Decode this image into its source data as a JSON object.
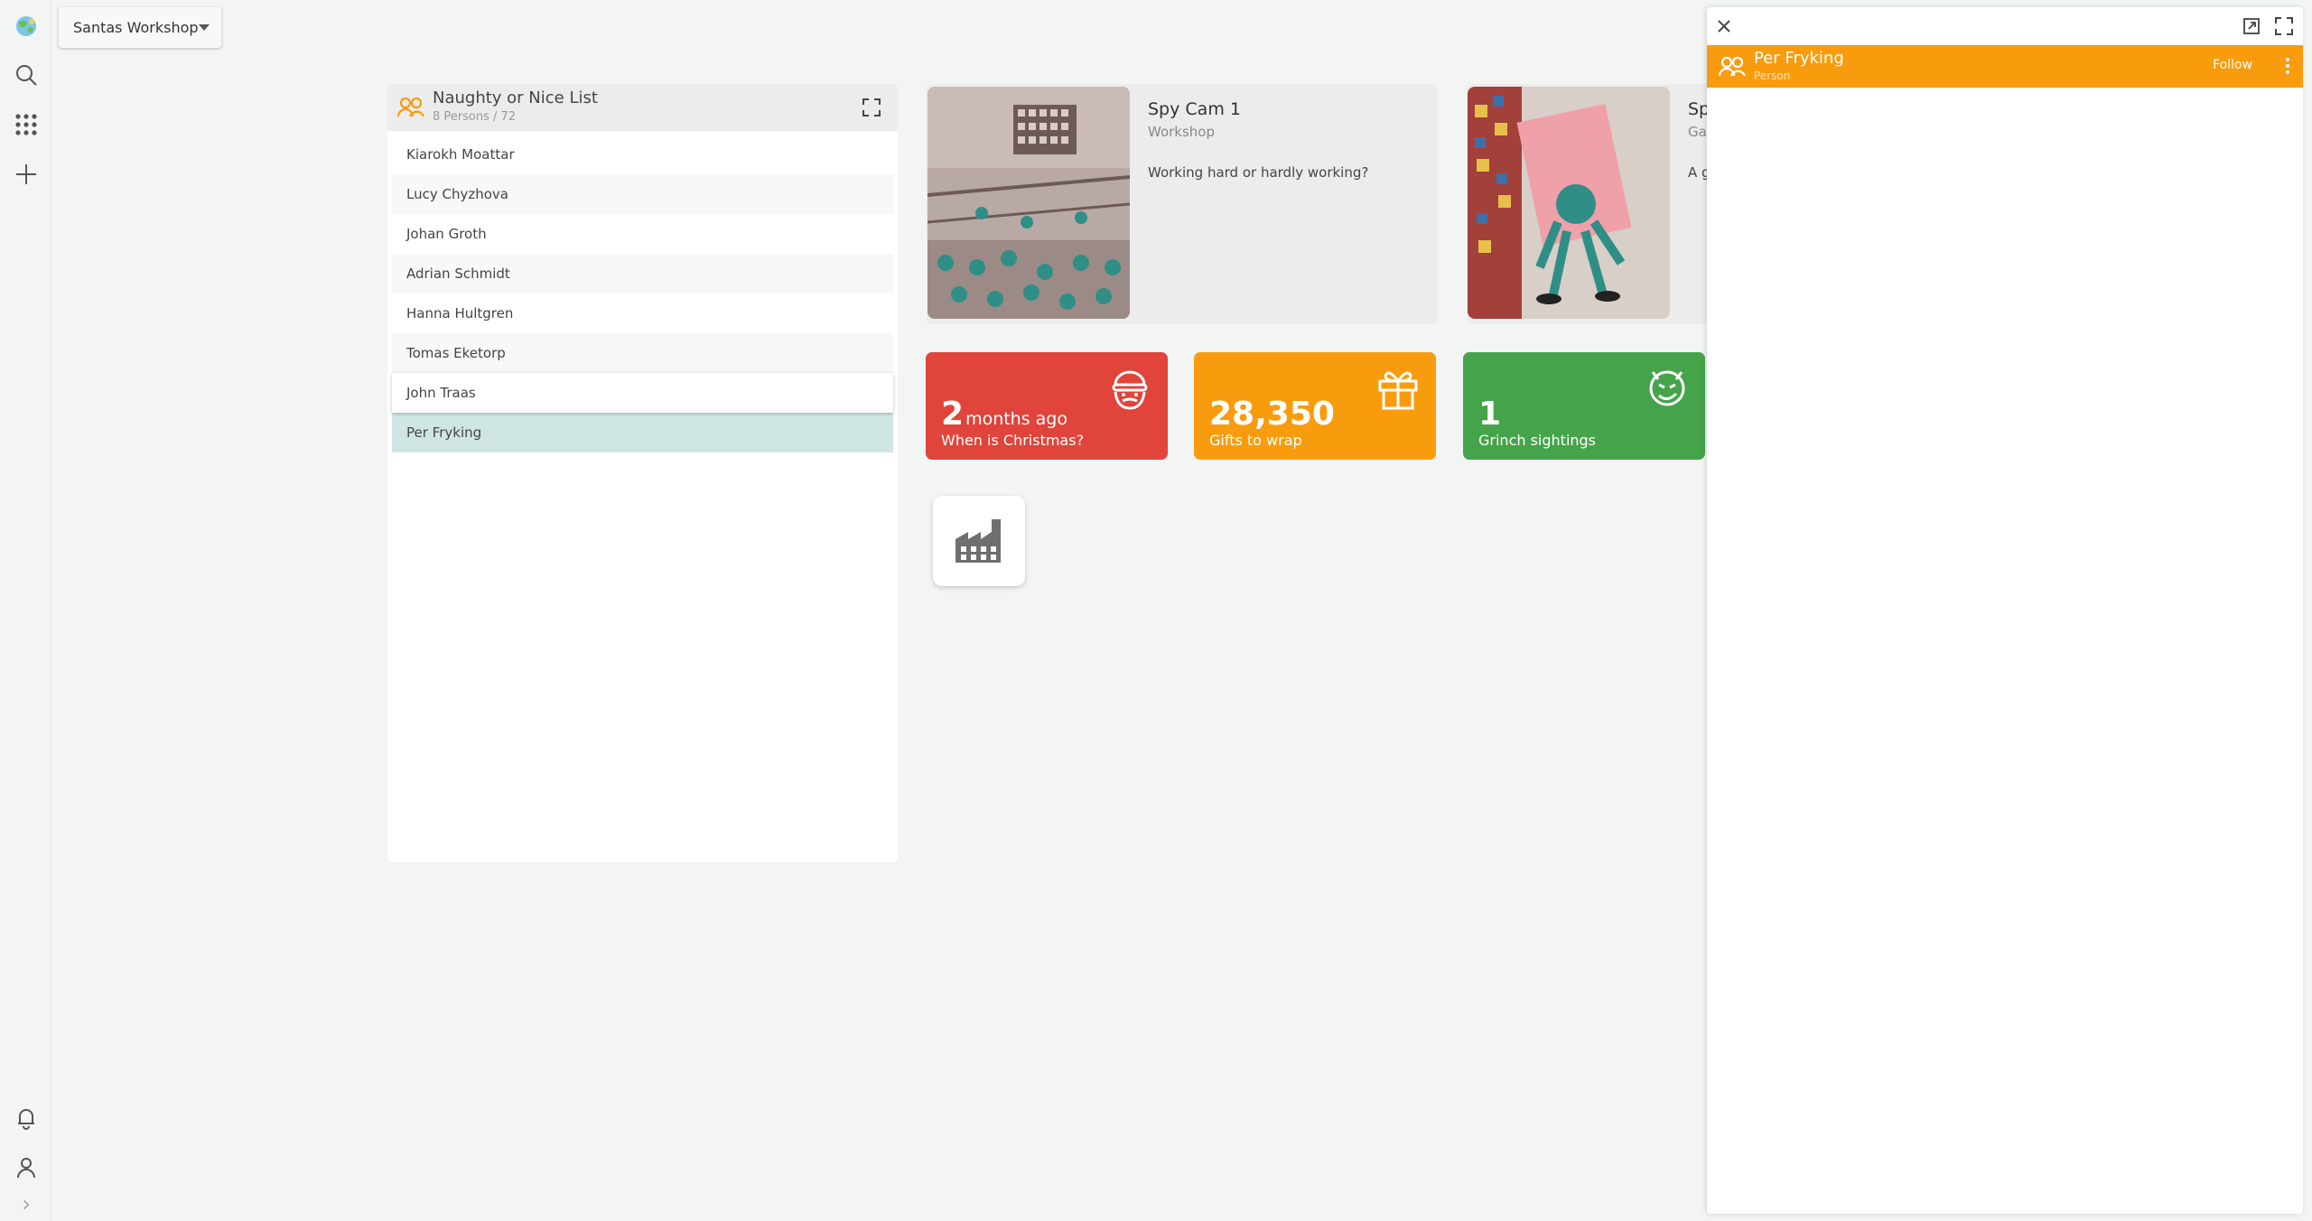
{
  "rail": {
    "top_icons": [
      "globe-logo-icon",
      "search-icon",
      "apps-grid-icon",
      "add-icon"
    ],
    "bottom_icons": [
      "bell-icon",
      "user-icon",
      "chevron-right-icon"
    ]
  },
  "workspace": {
    "name": "Santas Workshop"
  },
  "list": {
    "title": "Naughty or Nice List",
    "subtitle": "8 Persons / 72",
    "rows": [
      "Kiarokh Moattar",
      "Lucy Chyzhova",
      "Johan Groth",
      "Adrian Schmidt",
      "Hanna Hultgren",
      "Tomas Eketorp",
      "John Traas",
      "Per Fryking"
    ]
  },
  "cams": [
    {
      "title": "Spy Cam 1",
      "subtitle": "Workshop",
      "description": "Working hard or hardly working?"
    },
    {
      "title": "Sp",
      "subtitle": "Ga",
      "description": "A g"
    }
  ],
  "tiles": [
    {
      "value": "2",
      "unit": "months ago",
      "label": "When is Christmas?",
      "color": "#e0443a",
      "icon": "santa-icon"
    },
    {
      "value": "28,350",
      "unit": "",
      "label": "Gifts to wrap",
      "color": "#f89c0e",
      "icon": "gift-icon"
    },
    {
      "value": "1",
      "unit": "",
      "label": "Grinch sightings",
      "color": "#45a44a",
      "icon": "grinch-face-icon"
    }
  ],
  "detail": {
    "name": "Per Fryking",
    "type": "Person",
    "follow_label": "Follow",
    "accent": "#f89c0e"
  }
}
